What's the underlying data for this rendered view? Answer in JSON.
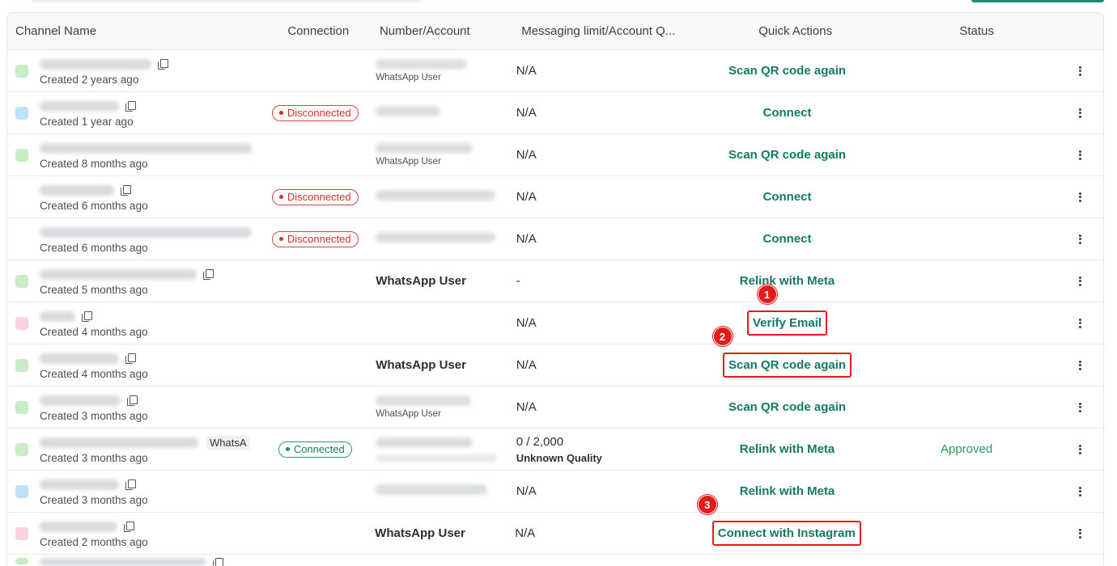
{
  "table": {
    "headers": {
      "channel_name": "Channel Name",
      "connection": "Connection",
      "number_account": "Number/Account",
      "messaging_limit": "Messaging limit/Account Q...",
      "quick_actions": "Quick Actions",
      "status": "Status"
    },
    "rows": [
      {
        "avatar": "green",
        "created": "Created 2 years ago",
        "connection": "",
        "number_sub": "WhatsApp User",
        "number_bold": "",
        "limit": "N/A",
        "action": "Scan QR code again",
        "status": ""
      },
      {
        "avatar": "blue",
        "created": "Created 1 year ago",
        "connection": "Disconnected",
        "number_sub": "",
        "number_bold": "",
        "limit": "N/A",
        "action": "Connect",
        "status": ""
      },
      {
        "avatar": "green",
        "created": "Created 8 months ago",
        "connection": "",
        "number_sub": "WhatsApp User",
        "number_bold": "",
        "limit": "N/A",
        "action": "Scan QR code again",
        "status": ""
      },
      {
        "avatar": "none",
        "created": "Created 6 months ago",
        "connection": "Disconnected",
        "number_sub": "",
        "number_bold": "",
        "limit": "N/A",
        "action": "Connect",
        "status": ""
      },
      {
        "avatar": "none",
        "created": "Created 6 months ago",
        "connection": "Disconnected",
        "number_sub": "",
        "number_bold": "",
        "limit": "N/A",
        "action": "Connect",
        "status": ""
      },
      {
        "avatar": "green",
        "created": "Created 5 months ago",
        "connection": "",
        "number_sub": "",
        "number_bold": "WhatsApp User",
        "limit": "-",
        "action": "Relink with Meta",
        "status": ""
      },
      {
        "avatar": "pink",
        "created": "Created 4 months ago",
        "connection": "",
        "number_sub": "",
        "number_bold": "",
        "limit": "N/A",
        "action": "Verify Email",
        "status": "",
        "marker": "1"
      },
      {
        "avatar": "green",
        "created": "Created 4 months ago",
        "connection": "",
        "number_sub": "",
        "number_bold": "WhatsApp User",
        "limit": "N/A",
        "action": "Scan QR code again",
        "status": "",
        "marker": "2"
      },
      {
        "avatar": "green",
        "created": "Created 3 months ago",
        "connection": "",
        "number_sub": "WhatsApp User",
        "number_bold": "",
        "limit": "N/A",
        "action": "Scan QR code again",
        "status": ""
      },
      {
        "avatar": "green",
        "created": "Created 3 months ago",
        "tag": "WhatsA",
        "connection": "Connected",
        "number_sub": "",
        "number_bold": "",
        "limit": "0 / 2,000",
        "limit_sub": "Unknown Quality",
        "action": "Relink with Meta",
        "status": "Approved"
      },
      {
        "avatar": "blue",
        "created": "Created 3 months ago",
        "connection": "",
        "number_sub": "",
        "number_bold": "",
        "limit": "N/A",
        "action": "Relink with Meta",
        "status": ""
      },
      {
        "avatar": "pink",
        "created": "Created 2 months ago",
        "connection": "",
        "number_sub": "",
        "number_bold": "WhatsApp User",
        "limit": "N/A",
        "action": "Connect with Instagram",
        "status": "",
        "marker": "3"
      }
    ]
  },
  "icons": {
    "copy": "copy-icon",
    "more": "more-vertical-icon",
    "status_dot": "status-dot-icon"
  },
  "colors": {
    "accent": "#157a62",
    "disconnected": "#d22f2f",
    "connected": "#1f8a70",
    "approved": "#2a9a5a",
    "annotation": "#e31b1b"
  }
}
